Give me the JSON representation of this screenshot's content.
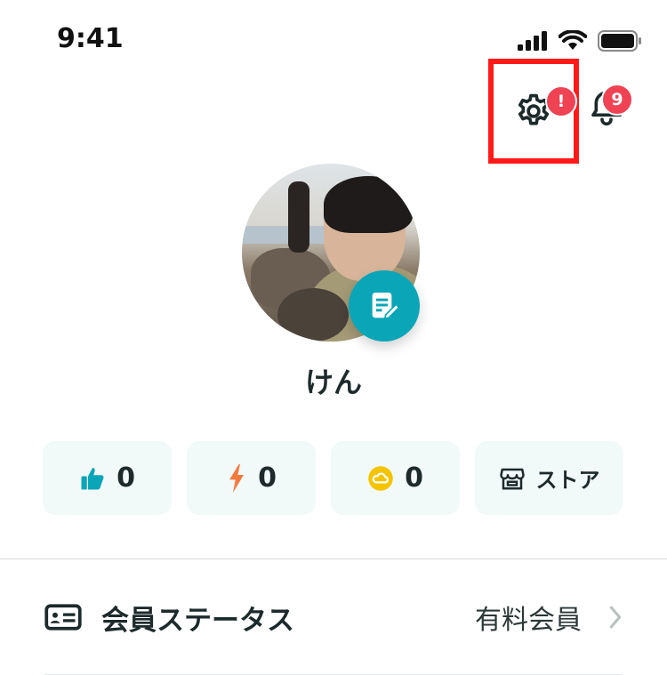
{
  "status_bar": {
    "time": "9:41"
  },
  "header": {
    "settings_badge": "!",
    "notifications_badge": "9",
    "highlight_color": "#ff1a1a"
  },
  "profile": {
    "name": "けん"
  },
  "stats": {
    "likes": "0",
    "energy": "0",
    "coins": "0",
    "store_label": "ストア"
  },
  "menu": {
    "member_status": {
      "label": "会員ステータス",
      "value": "有料会員"
    }
  },
  "colors": {
    "accent": "#0aa6b8",
    "badge": "#ef4354",
    "card_bg": "#f2f9f9"
  }
}
